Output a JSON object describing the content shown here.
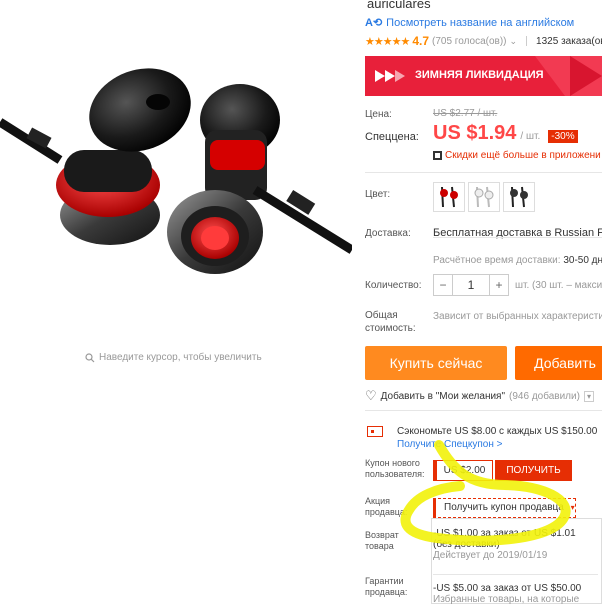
{
  "title_tail": "auriculares",
  "translate_link": "Посмотреть название на английском",
  "rating": {
    "score": "4.7",
    "votes": "(705 голоса(ов))",
    "orders": "1325 заказа(ов)"
  },
  "banner": {
    "text": "ЗИМНЯЯ ЛИКВИДАЦИЯ",
    "color": "#e8203a"
  },
  "price": {
    "label": "Цена:",
    "old": "US $2.77 / шт."
  },
  "special": {
    "label": "Спеццена:",
    "value": "US $1.94",
    "unit": "/ шт.",
    "discount": "-30%",
    "app_note": "Скидки ещё больше в приложени"
  },
  "color": {
    "label": "Цвет:"
  },
  "shipping": {
    "label": "Доставка:",
    "value": "Бесплатная доставка в Russian Fed",
    "time": "Расчётное время доставки: ",
    "time_value": "30-50 дн"
  },
  "quantity": {
    "label": "Количество:",
    "minus": "−",
    "value": "1",
    "plus": "+",
    "note": "шт. (30 шт. – макси"
  },
  "total": {
    "label": "Общая стоимость:",
    "value": "Зависит от выбранных характеристи"
  },
  "actions": {
    "buy": "Купить сейчас",
    "add": "Добавить"
  },
  "wishlist": {
    "text": "Добавить в \"Мои желания\"",
    "count": "(946 добавили)"
  },
  "save": {
    "text": "Сэкономьте US $8.00 с каждых US $150.00",
    "link": "Получите Спецкупон >"
  },
  "new_user_coupon": {
    "label": "Купон нового пользователя:",
    "value": "US $2.00",
    "button": "ПОЛУЧИТЬ"
  },
  "seller_promo": {
    "label": "Акция продавца:",
    "select": "Получить купон продавца"
  },
  "return": {
    "label": "Возврат товара"
  },
  "guarantees": {
    "label": "Гарантии продавца:"
  },
  "coupons": [
    {
      "line1": "-US $1.00 за заказ от US $1.01",
      "line2": "(без доставки)",
      "valid": "Действует до 2019/01/19"
    },
    {
      "line1": "-US $5.00 за заказ от US $50.00",
      "line2": "Избранные товары, на которые"
    }
  ],
  "zoom_hint": "Наведите курсор, чтобы увеличить",
  "accent": "#ff4747",
  "icons": [
    "translate-icon",
    "star-icon",
    "qr-icon",
    "search-icon",
    "heart-icon",
    "coupon-icon",
    "chevron-down-icon"
  ]
}
